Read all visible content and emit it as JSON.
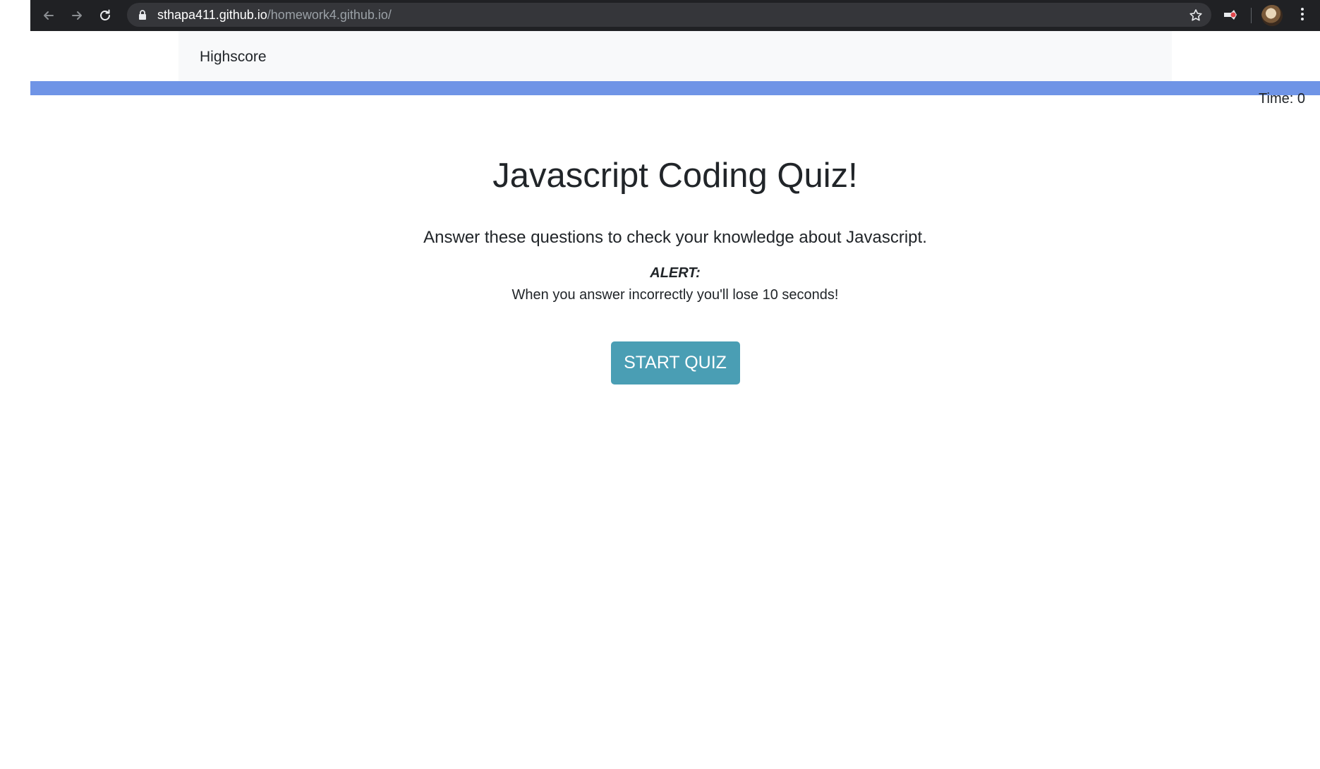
{
  "browser": {
    "url_host": "sthapa411.github.io",
    "url_path": "/homework4.github.io/",
    "icons": [
      "back-arrow-icon",
      "forward-arrow-icon",
      "reload-icon",
      "lock-icon",
      "bookmark-star-icon",
      "extension-icon",
      "profile-avatar",
      "menu-dots-icon"
    ]
  },
  "nav": {
    "highscore_label": "Highscore"
  },
  "progress": {
    "fraction": 1.0,
    "color": "#6f94e6"
  },
  "timer": {
    "label": "Time: ",
    "value": "0"
  },
  "quiz": {
    "title": "Javascript Coding Quiz!",
    "lead": "Answer these questions to check your knowledge about Javascript.",
    "alert_label": "ALERT:",
    "alert_text": "When you answer incorrectly you'll lose 10 seconds!",
    "start_button": "START QUIZ",
    "start_button_color": "#4a9eb4"
  }
}
